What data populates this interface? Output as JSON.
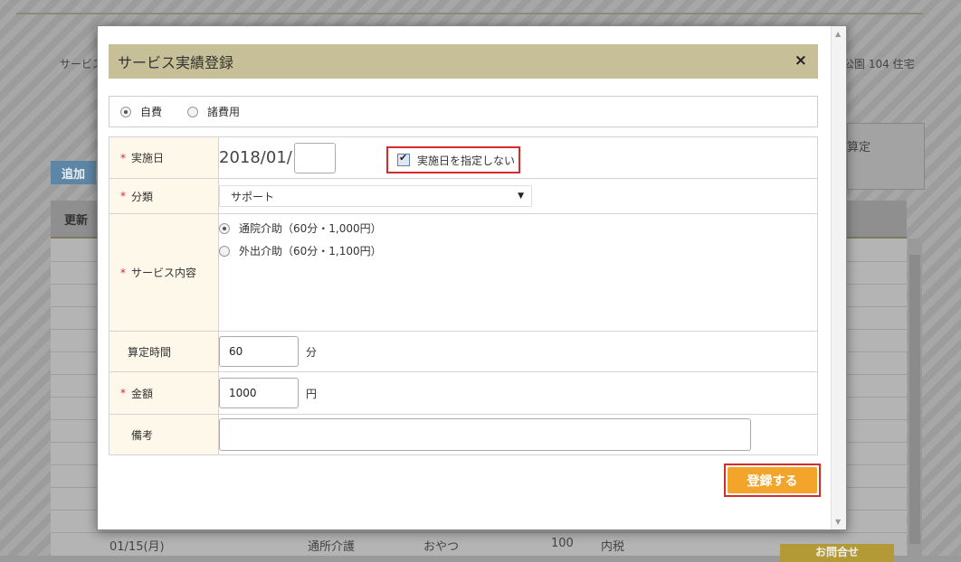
{
  "background": {
    "service_label_fragment": "サービス",
    "address_fragment": "公園 104 住宅",
    "right_label_fragment": "算定",
    "add_button": "追加",
    "tab_label": "更新",
    "last_row": {
      "date": "01/15(月)",
      "service": "通所介護",
      "item": "おやつ",
      "amount": "100",
      "tax": "内税"
    },
    "yellow_button_fragment": "お問合せ"
  },
  "modal": {
    "title": "サービス実績登録",
    "close": "×",
    "payment_types": [
      {
        "label": "自費",
        "selected": true
      },
      {
        "label": "諸費用",
        "selected": false
      }
    ],
    "date": {
      "label": "実施日",
      "prefix": "2018/01/",
      "day_value": "",
      "no_date_label": "実施日を指定しない",
      "no_date_checked": true
    },
    "category": {
      "label": "分類",
      "selected": "サポート"
    },
    "service": {
      "label": "サービス内容",
      "options": [
        {
          "label": "通院介助（60分・1,000円）",
          "selected": true
        },
        {
          "label": "外出介助（60分・1,100円）",
          "selected": false
        }
      ]
    },
    "time": {
      "label": "算定時間",
      "value": "60",
      "unit": "分"
    },
    "amount": {
      "label": "金額",
      "value": "1000",
      "unit": "円"
    },
    "note": {
      "label": "備考",
      "value": ""
    },
    "submit_label": "登録する"
  },
  "colors": {
    "header_bg": "#c6bf98",
    "label_bg": "#fdf8ea",
    "required": "#d9262d",
    "submit": "#f2a52a",
    "highlight": "#d42b2b"
  }
}
